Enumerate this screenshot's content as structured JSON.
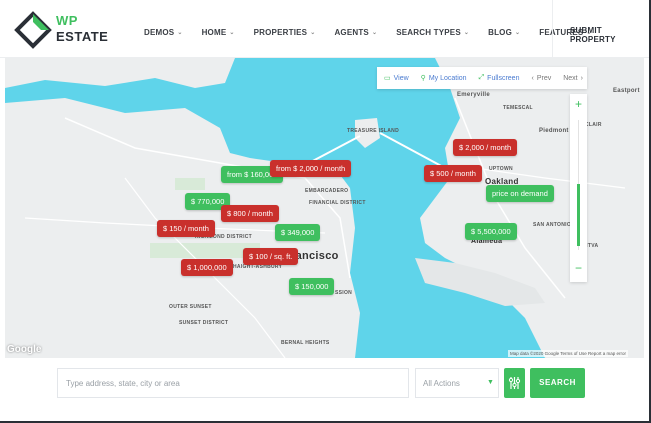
{
  "brand": {
    "line1": "WP",
    "line2": "ESTATE"
  },
  "nav": {
    "items": [
      {
        "label": "DEMOS"
      },
      {
        "label": "HOME"
      },
      {
        "label": "PROPERTIES"
      },
      {
        "label": "AGENTS"
      },
      {
        "label": "SEARCH TYPES"
      },
      {
        "label": "BLOG"
      },
      {
        "label": "FEATURES"
      }
    ],
    "submit_label": "SUBMIT PROPERTY"
  },
  "map": {
    "toolbar": {
      "view": "View",
      "my_location": "My Location",
      "fullscreen": "Fullscreen",
      "prev": "Prev",
      "next": "Next"
    },
    "zoom": {
      "plus": "+",
      "minus": "−"
    },
    "labels": {
      "emeryville": "Emeryville",
      "temescal": "TEMESCAL",
      "piedmont": "Piedmont",
      "eastport": "Eastport",
      "clair": "CLAIR",
      "treasure_island": "TREASURE ISLAND",
      "uptown": "UPTOWN",
      "oakland": "Oakland",
      "embarcadero": "EMBARCADERO",
      "financial": "FINANCIAL DISTRICT",
      "richmond": "RICHMOND DISTRICT",
      "san_antonio": "SAN ANTONIO",
      "fruitvale": "FRUITVA",
      "alameda": "Alameda",
      "haight": "HAIGHT-ASHBURY",
      "francisco": "rancisco",
      "outer_sunset": "OUTER SUNSET",
      "sunset": "SUNSET DISTRICT",
      "bernal": "BERNAL HEIGHTS",
      "mission": "SSION"
    },
    "pins": [
      {
        "label": "from $ 160,000",
        "color": "green"
      },
      {
        "label": "from $ 2,000 / month",
        "color": "red"
      },
      {
        "label": "$ 770,000",
        "color": "green"
      },
      {
        "label": "$ 800 / month",
        "color": "red"
      },
      {
        "label": "$ 150 / month",
        "color": "red"
      },
      {
        "label": "$ 349,000",
        "color": "green"
      },
      {
        "label": "$ 100 / sq. ft.",
        "color": "red"
      },
      {
        "label": "$ 1,000,000",
        "color": "red"
      },
      {
        "label": "$ 150,000",
        "color": "green"
      },
      {
        "label": "$ 2,000 / month",
        "color": "red"
      },
      {
        "label": "$ 500 / month",
        "color": "red"
      },
      {
        "label": "price on demand",
        "color": "green"
      },
      {
        "label": "$ 5,500,000",
        "color": "green"
      }
    ],
    "google": "Google",
    "attribution": "Map data ©2020 Google   Terms of Use   Report a map error"
  },
  "search": {
    "placeholder": "Type address, state, city or area",
    "actions_value": "All Actions",
    "button": "SEARCH"
  },
  "colors": {
    "accent": "#3fbf5f",
    "red_pin": "#c9302c",
    "water": "#5fd4ea",
    "land": "#eceeef"
  }
}
